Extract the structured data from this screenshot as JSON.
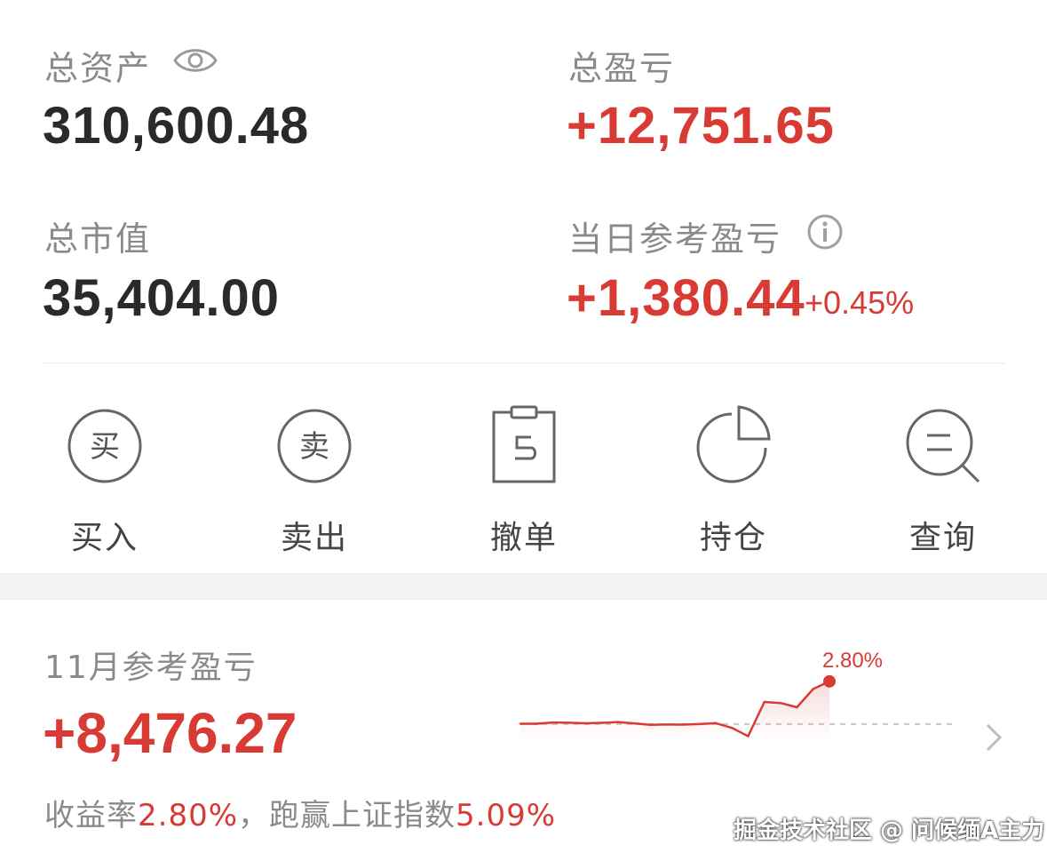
{
  "summary": {
    "total_assets_label": "总资产",
    "total_assets_value": "310,600.48",
    "total_pnl_label": "总盈亏",
    "total_pnl_value": "+12,751.65",
    "market_value_label": "总市值",
    "market_value_value": "35,404.00",
    "daily_pnl_label": "当日参考盈亏",
    "daily_pnl_value": "+1,380.44",
    "daily_pnl_percent": "+0.45%"
  },
  "actions": [
    {
      "label": "买入",
      "icon": "buy-icon",
      "glyph": "买"
    },
    {
      "label": "卖出",
      "icon": "sell-icon",
      "glyph": "卖"
    },
    {
      "label": "撤单",
      "icon": "cancel-order-icon"
    },
    {
      "label": "持仓",
      "icon": "pie-chart-icon"
    },
    {
      "label": "查询",
      "icon": "search-icon"
    }
  ],
  "monthly": {
    "label": "11月参考盈亏",
    "value": "+8,476.27",
    "yield_label": "收益率",
    "yield_value": "2.80%",
    "beat_label": "，跑赢上证指数",
    "beat_value": "5.09%"
  },
  "chart_data": {
    "type": "line",
    "title": "",
    "xlabel": "",
    "ylabel": "",
    "series": [
      {
        "values": [
          0.02,
          0.02,
          0.1,
          0.09,
          0.05,
          0.08,
          0.13,
          0.04,
          -0.05,
          -0.03,
          -0.04,
          0.0,
          0.06,
          -0.25,
          -0.8,
          1.45,
          1.38,
          1.1,
          2.3,
          2.8
        ]
      }
    ],
    "end_label": "2.80%",
    "baseline": 0,
    "ylim": [
      -1.0,
      3.2
    ]
  },
  "watermark": "掘金技术社区 @ 问候缅A主力",
  "colors": {
    "accent_red": "#d83a34",
    "text_dark": "#2a2a2a",
    "text_gray": "#8a8a8a"
  }
}
